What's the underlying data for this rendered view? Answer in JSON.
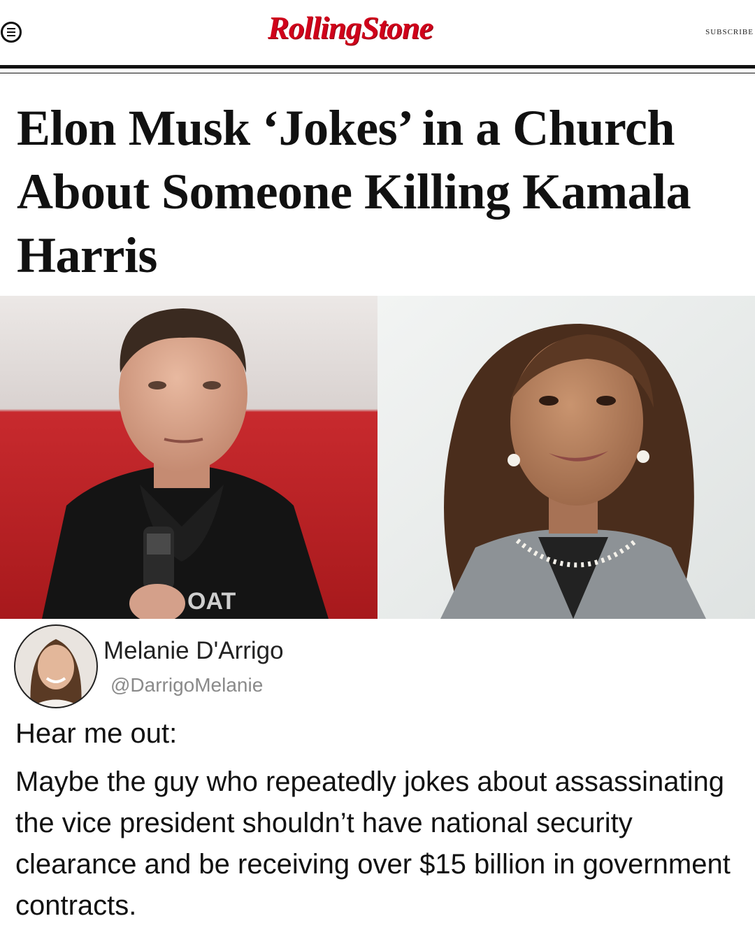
{
  "header": {
    "logo_text": "RollingStone",
    "subscribe_label": "SUBSCRIBE",
    "menu_icon": "menu-icon",
    "brand_color": "#d0021b"
  },
  "article": {
    "headline": "Elon Musk ‘Jokes’ in a Church About Someone Killing Kamala Harris",
    "photo_left_caption_text": "OAT"
  },
  "tweet": {
    "author_name": "Melanie D'Arrigo",
    "author_handle": "@DarrigoMelanie",
    "lead": "Hear me out:",
    "body": "Maybe the guy who repeatedly jokes about assassinating the vice president shouldn’t have national security clearance and be receiving over $15 billion in government contracts."
  }
}
